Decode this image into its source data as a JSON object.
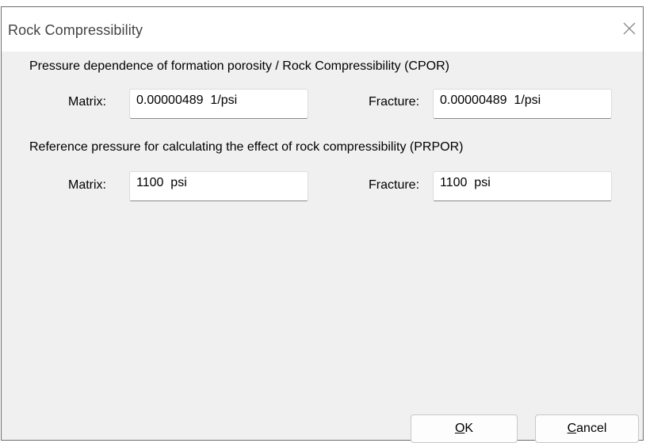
{
  "window": {
    "title": "Rock Compressibility",
    "close_icon": "close-icon"
  },
  "cpor": {
    "heading": "Pressure dependence of formation porosity / Rock Compressibility (CPOR)",
    "matrix_label": "Matrix:",
    "matrix_value": "0.00000489  1/psi",
    "fracture_label": "Fracture:",
    "fracture_value": "0.00000489  1/psi"
  },
  "prpor": {
    "heading": "Reference pressure for calculating the effect of rock compressibility (PRPOR)",
    "matrix_label": "Matrix:",
    "matrix_value": "1100  psi",
    "fracture_label": "Fracture:",
    "fracture_value": "1100  psi"
  },
  "buttons": {
    "ok_mnemonic": "O",
    "ok_rest": "K",
    "cancel_mnemonic": "C",
    "cancel_rest": "ancel"
  }
}
